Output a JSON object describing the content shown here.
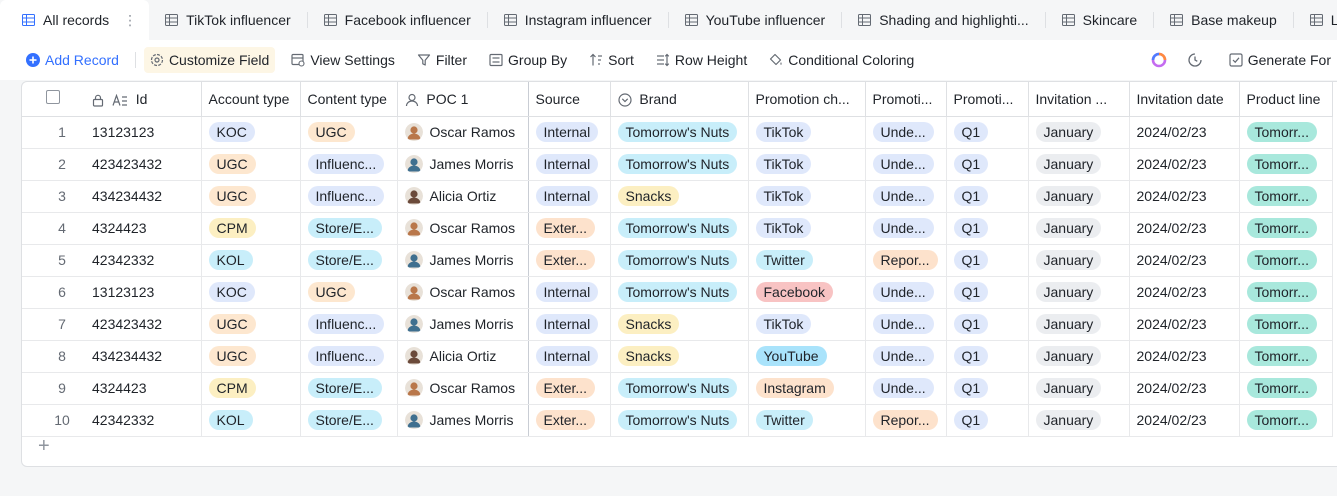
{
  "tabs": [
    {
      "label": "All records",
      "active": true
    },
    {
      "label": "TikTok influencer"
    },
    {
      "label": "Facebook influencer"
    },
    {
      "label": "Instagram influencer"
    },
    {
      "label": "YouTube influencer"
    },
    {
      "label": "Shading and highlighti..."
    },
    {
      "label": "Skincare"
    },
    {
      "label": "Base makeup"
    },
    {
      "label": "LI"
    }
  ],
  "toolbar": {
    "add_record": "Add Record",
    "customize_field": "Customize Field",
    "view_settings": "View Settings",
    "filter": "Filter",
    "group_by": "Group By",
    "sort": "Sort",
    "row_height": "Row Height",
    "conditional_coloring": "Conditional Coloring",
    "generate_form": "Generate For"
  },
  "columns": [
    "Id",
    "Account type",
    "Content type",
    "POC 1",
    "Source",
    "Brand",
    "Promotion ch...",
    "Promoti...",
    "Promoti...",
    "Invitation ...",
    "Invitation date",
    "Product line"
  ],
  "rows": [
    {
      "n": "1",
      "id": "13123123",
      "account": "KOC",
      "content": "UGC",
      "poc": "Oscar Ramos",
      "source": "Internal",
      "brand": "Tomorrow's Nuts",
      "channel": "TikTok",
      "status": "Unde...",
      "quarter": "Q1",
      "month": "January",
      "date": "2024/02/23",
      "product": "Tomorr..."
    },
    {
      "n": "2",
      "id": "423423432",
      "account": "UGC",
      "content": "Influenc...",
      "poc": "James Morris",
      "source": "Internal",
      "brand": "Tomorrow's Nuts",
      "channel": "TikTok",
      "status": "Unde...",
      "quarter": "Q1",
      "month": "January",
      "date": "2024/02/23",
      "product": "Tomorr..."
    },
    {
      "n": "3",
      "id": "434234432",
      "account": "UGC",
      "content": "Influenc...",
      "poc": "Alicia Ortiz",
      "source": "Internal",
      "brand": "Snacks",
      "channel": "TikTok",
      "status": "Unde...",
      "quarter": "Q1",
      "month": "January",
      "date": "2024/02/23",
      "product": "Tomorr..."
    },
    {
      "n": "4",
      "id": "4324423",
      "account": "CPM",
      "content": "Store/E...",
      "poc": "Oscar Ramos",
      "source": "Exter...",
      "brand": "Tomorrow's Nuts",
      "channel": "TikTok",
      "status": "Unde...",
      "quarter": "Q1",
      "month": "January",
      "date": "2024/02/23",
      "product": "Tomorr..."
    },
    {
      "n": "5",
      "id": "42342332",
      "account": "KOL",
      "content": "Store/E...",
      "poc": "James Morris",
      "source": "Exter...",
      "brand": "Tomorrow's Nuts",
      "channel": "Twitter",
      "status": "Repor...",
      "quarter": "Q1",
      "month": "January",
      "date": "2024/02/23",
      "product": "Tomorr..."
    },
    {
      "n": "6",
      "id": "13123123",
      "account": "KOC",
      "content": "UGC",
      "poc": "Oscar Ramos",
      "source": "Internal",
      "brand": "Tomorrow's Nuts",
      "channel": "Facebook",
      "status": "Unde...",
      "quarter": "Q1",
      "month": "January",
      "date": "2024/02/23",
      "product": "Tomorr..."
    },
    {
      "n": "7",
      "id": "423423432",
      "account": "UGC",
      "content": "Influenc...",
      "poc": "James Morris",
      "source": "Internal",
      "brand": "Snacks",
      "channel": "TikTok",
      "status": "Unde...",
      "quarter": "Q1",
      "month": "January",
      "date": "2024/02/23",
      "product": "Tomorr..."
    },
    {
      "n": "8",
      "id": "434234432",
      "account": "UGC",
      "content": "Influenc...",
      "poc": "Alicia Ortiz",
      "source": "Internal",
      "brand": "Snacks",
      "channel": "YouTube",
      "status": "Unde...",
      "quarter": "Q1",
      "month": "January",
      "date": "2024/02/23",
      "product": "Tomorr..."
    },
    {
      "n": "9",
      "id": "4324423",
      "account": "CPM",
      "content": "Store/E...",
      "poc": "Oscar Ramos",
      "source": "Exter...",
      "brand": "Tomorrow's Nuts",
      "channel": "Instagram",
      "status": "Unde...",
      "quarter": "Q1",
      "month": "January",
      "date": "2024/02/23",
      "product": "Tomorr..."
    },
    {
      "n": "10",
      "id": "42342332",
      "account": "KOL",
      "content": "Store/E...",
      "poc": "James Morris",
      "source": "Exter...",
      "brand": "Tomorrow's Nuts",
      "channel": "Twitter",
      "status": "Repor...",
      "quarter": "Q1",
      "month": "January",
      "date": "2024/02/23",
      "product": "Tomorr..."
    }
  ],
  "colors": {
    "accent": "#3370ff",
    "customize_bg": "#fdf6e5"
  }
}
